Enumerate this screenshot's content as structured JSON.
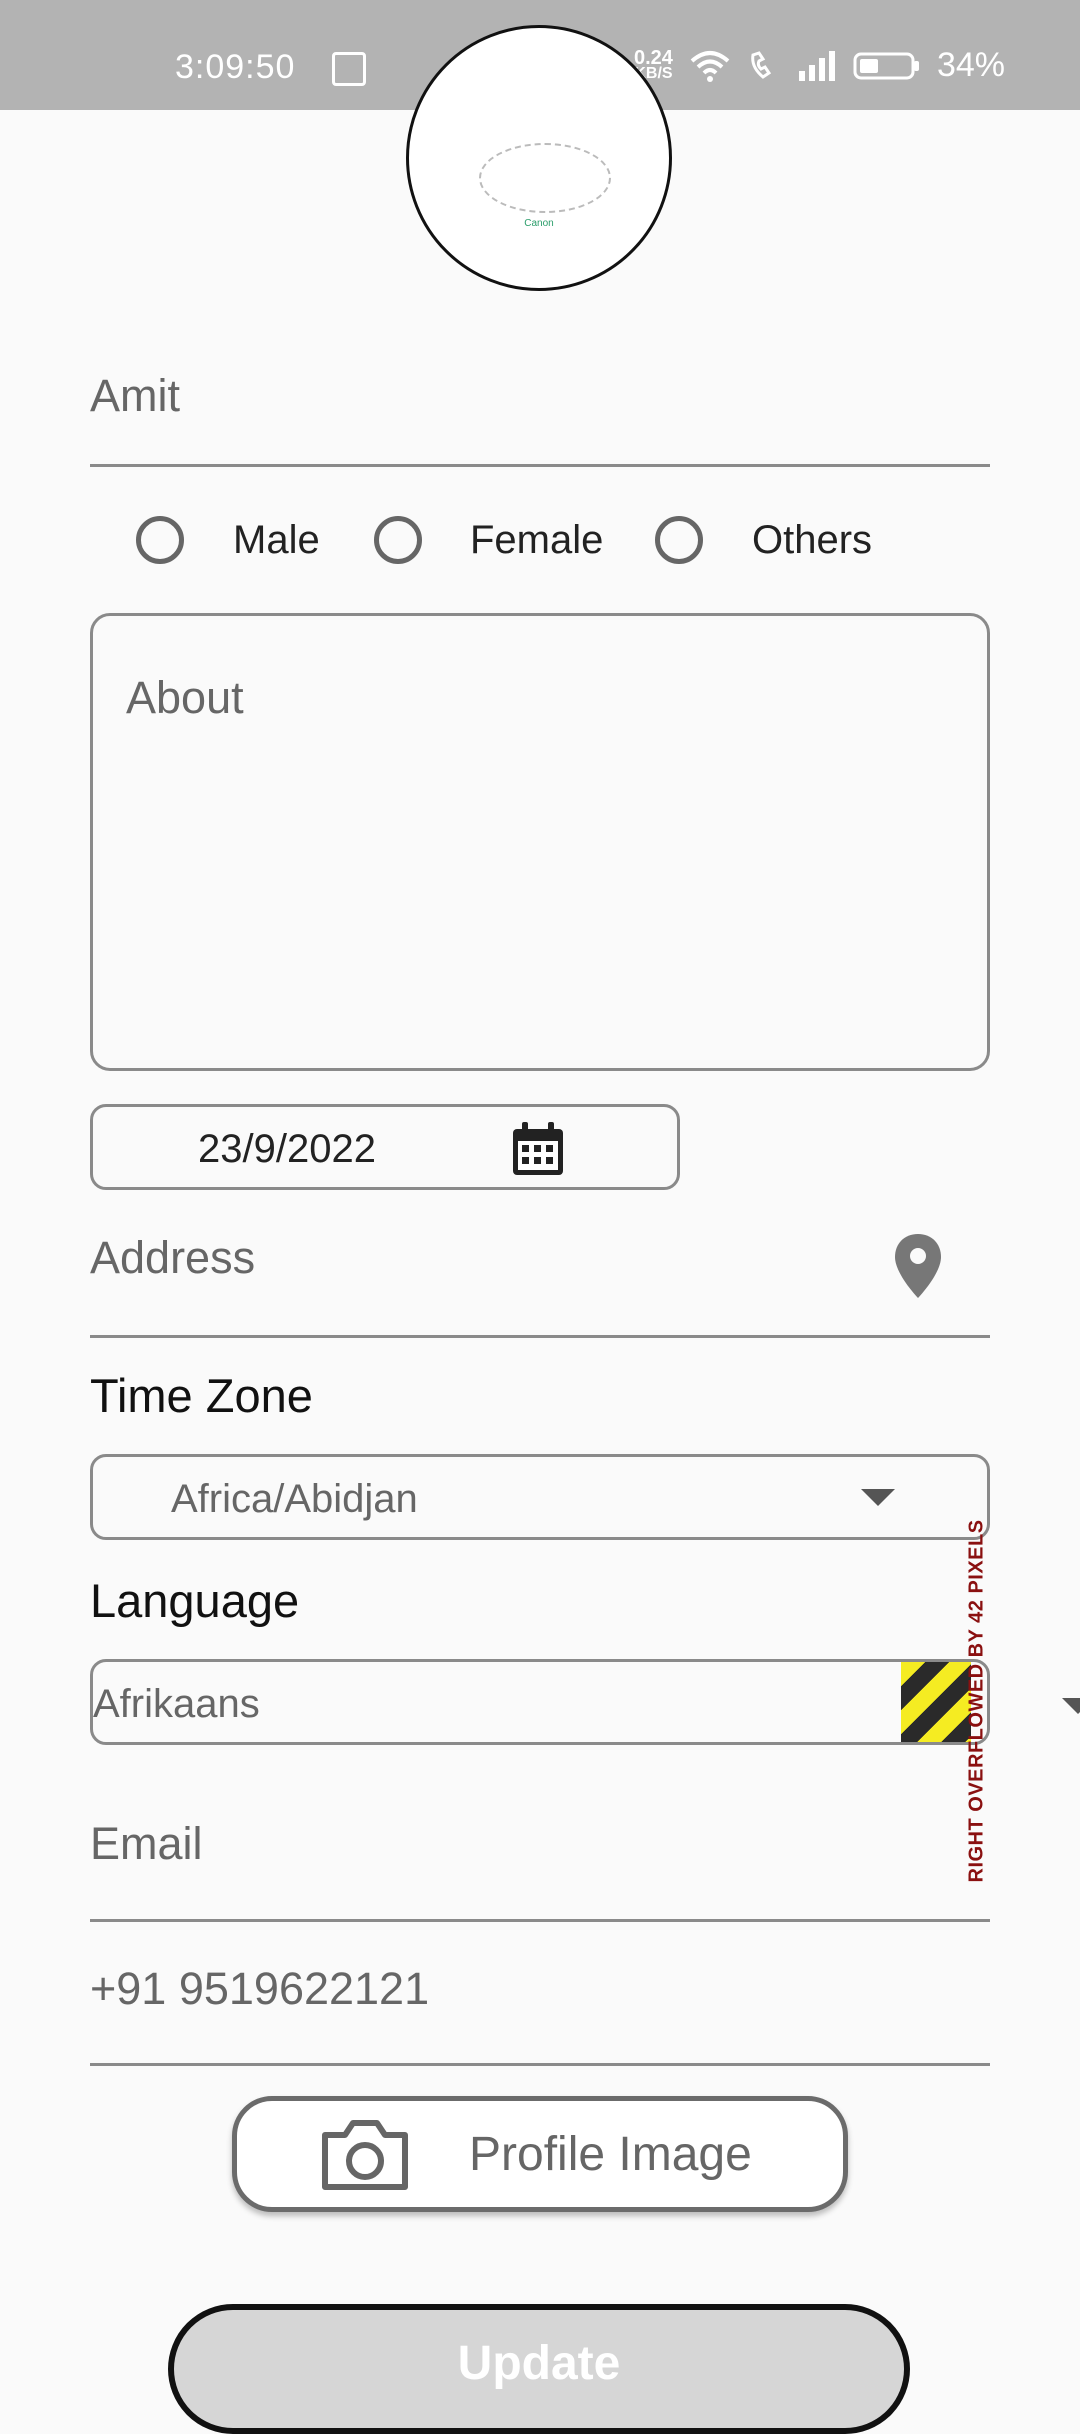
{
  "status_bar": {
    "time": "3:09:50",
    "net_speed_value": "0.24",
    "net_speed_unit": "KB/S",
    "battery": "34%"
  },
  "form": {
    "name_value": "Amit",
    "gender_options": [
      "Male",
      "Female",
      "Others"
    ],
    "about_placeholder": "About",
    "date_value": "23/9/2022",
    "address_placeholder": "Address",
    "timezone_label": "Time Zone",
    "timezone_value": "Africa/Abidjan",
    "language_label": "Language",
    "language_value": "Afrikaans",
    "overflow_warning": "RIGHT OVERFLOWED BY 42 PIXELS",
    "email_placeholder": "Email",
    "phone_value": "+91 9519622121",
    "profile_image_label": "Profile Image",
    "update_label": "Update"
  },
  "colors": {
    "status_bar": "#b3b3b3",
    "hazard_yellow": "#f5ec22",
    "hazard_dark": "#2a2a2a",
    "overflow_text": "#8a1010",
    "update_bg": "#d6d6d6"
  }
}
